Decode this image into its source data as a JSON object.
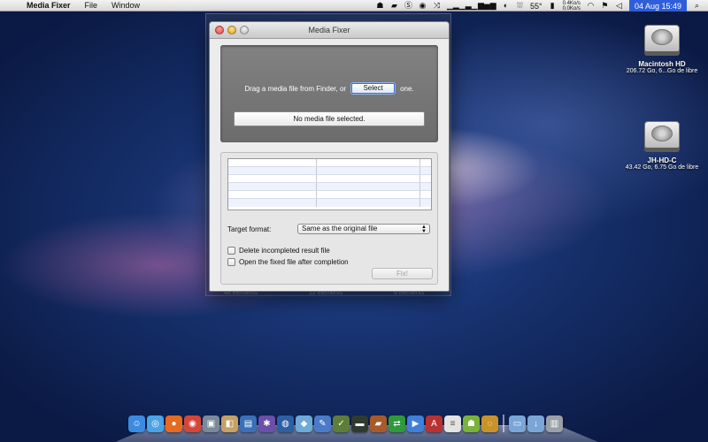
{
  "menubar": {
    "app_name": "Media Fixer",
    "menus": [
      "File",
      "Window"
    ],
    "temperature": "55°",
    "net_up": "0.4Ko/s",
    "net_down": "0.0Ko/s",
    "clock": "04 Aug 15:49"
  },
  "window": {
    "title": "Media Fixer",
    "drag_prefix": "Drag a media file from Finder, or",
    "select_label": "Select",
    "drag_suffix": "one.",
    "status": "No media file selected.",
    "target_format_label": "Target format:",
    "target_format_value": "Same as the original file",
    "delete_incompleted_label": "Delete incompleted result file",
    "open_fixed_label": "Open the fixed file after completion",
    "fix_label": "Fix!"
  },
  "desktop": {
    "drives": [
      {
        "name": "Macintosh HD",
        "detail": "206.72 Go, 6...Go de libre"
      },
      {
        "name": "JH-HD-C",
        "detail": "43.42 Go, 6.75 Go de libre"
      }
    ],
    "bg_labels": [
      "48 éléments",
      "12 éléments",
      "6 éléments"
    ]
  },
  "dock": {
    "icons": [
      {
        "name": "finder-icon",
        "color": "#3b8be0",
        "glyph": "☺"
      },
      {
        "name": "safari-icon",
        "color": "#4aa3e6",
        "glyph": "◎"
      },
      {
        "name": "firefox-icon",
        "color": "#e66a1f",
        "glyph": "●"
      },
      {
        "name": "chrome-icon",
        "color": "#d44638",
        "glyph": "◉"
      },
      {
        "name": "preview-icon",
        "color": "#7a8a99",
        "glyph": "▣"
      },
      {
        "name": "photo-icon",
        "color": "#c4a165",
        "glyph": "◧"
      },
      {
        "name": "app-icon",
        "color": "#3b6fb8",
        "glyph": "▤"
      },
      {
        "name": "bug-icon",
        "color": "#6b4fa8",
        "glyph": "✱"
      },
      {
        "name": "globe-icon",
        "color": "#2d5fa3",
        "glyph": "◍"
      },
      {
        "name": "cube-icon",
        "color": "#6ea9d8",
        "glyph": "◆"
      },
      {
        "name": "pen-icon",
        "color": "#4a7bc8",
        "glyph": "✎"
      },
      {
        "name": "utility-icon",
        "color": "#5e7d3a",
        "glyph": "✓"
      },
      {
        "name": "terminal-icon",
        "color": "#2e3b2e",
        "glyph": "▬"
      },
      {
        "name": "box-icon",
        "color": "#a85a2a",
        "glyph": "▰"
      },
      {
        "name": "sync-icon",
        "color": "#2f9a3a",
        "glyph": "⇄"
      },
      {
        "name": "media-icon",
        "color": "#3f7fd8",
        "glyph": "▶"
      },
      {
        "name": "dictionary-icon",
        "color": "#b83232",
        "glyph": "A"
      },
      {
        "name": "notes-icon",
        "color": "#e3e3e3",
        "glyph": "≡"
      },
      {
        "name": "android-icon",
        "color": "#7ab33a",
        "glyph": "☗"
      },
      {
        "name": "ring-icon",
        "color": "#c8932a",
        "glyph": "◌"
      },
      {
        "name": "folder-icon",
        "color": "#7aa6d6",
        "glyph": "▭"
      },
      {
        "name": "downloads-icon",
        "color": "#7aa6d6",
        "glyph": "↓"
      },
      {
        "name": "trash-icon",
        "color": "#9aa0a8",
        "glyph": "▥"
      }
    ]
  }
}
